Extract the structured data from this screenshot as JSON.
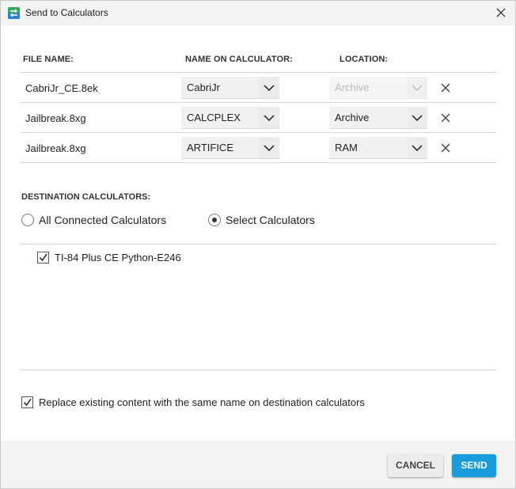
{
  "window": {
    "title": "Send to Calculators"
  },
  "table": {
    "headers": {
      "file_name": "FILE NAME:",
      "name_on_calculator": "NAME ON CALCULATOR:",
      "location": "LOCATION:"
    },
    "rows": [
      {
        "file_name": "CabriJr_CE.8ek",
        "calc_name": "CabriJr",
        "location": "Archive",
        "location_disabled": true
      },
      {
        "file_name": "Jailbreak.8xg",
        "calc_name": "CALCPLEX",
        "location": "Archive",
        "location_disabled": false
      },
      {
        "file_name": "Jailbreak.8xg",
        "calc_name": "ARTIFICE",
        "location": "RAM",
        "location_disabled": false
      }
    ]
  },
  "destination": {
    "label": "DESTINATION CALCULATORS:",
    "options": [
      {
        "label": "All Connected Calculators",
        "selected": false
      },
      {
        "label": "Select Calculators",
        "selected": true
      }
    ],
    "calculators": [
      {
        "label": "TI-84 Plus CE Python-E246",
        "checked": true
      }
    ]
  },
  "replace_option": {
    "label": "Replace existing content with the same name on destination calculators",
    "checked": true
  },
  "buttons": {
    "cancel": "CANCEL",
    "send": "SEND"
  },
  "colors": {
    "accent": "#1a9bdc",
    "title_bar": "#f3f3f3",
    "footer": "#f3f3f3",
    "field_bg": "#f1f1f1"
  }
}
